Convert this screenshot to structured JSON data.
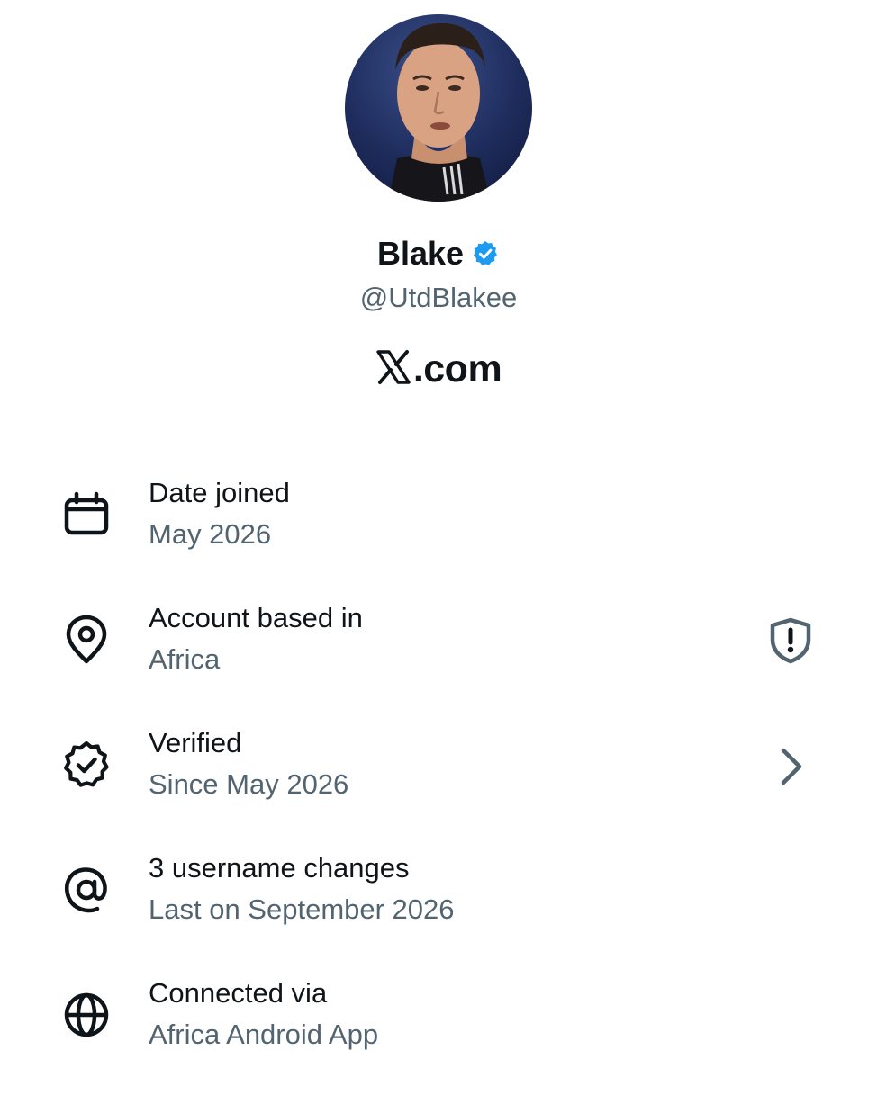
{
  "profile": {
    "display_name": "Blake",
    "handle": "@UtdBlakee",
    "site": ".com",
    "verified_color": "#1d9bf0"
  },
  "rows": [
    {
      "icon": "calendar-icon",
      "title": "Date joined",
      "subtitle": "May 2026"
    },
    {
      "icon": "location-pin-icon",
      "title": "Account based in",
      "subtitle": "Africa",
      "trailing_icon": "shield-alert-icon"
    },
    {
      "icon": "verified-badge-icon",
      "title": "Verified",
      "subtitle": "Since May 2026",
      "trailing_icon": "chevron-right-icon"
    },
    {
      "icon": "at-sign-icon",
      "title": "3 username changes",
      "subtitle": "Last on September 2026"
    },
    {
      "icon": "globe-icon",
      "title": "Connected via",
      "subtitle": "Africa Android App"
    }
  ],
  "colors": {
    "primary_text": "#0f1419",
    "secondary_text": "#536471"
  }
}
